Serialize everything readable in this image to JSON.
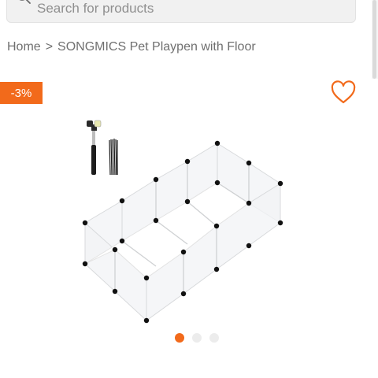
{
  "search": {
    "placeholder": "Search for products",
    "value": ""
  },
  "breadcrumb": {
    "home": "Home",
    "separator": ">",
    "current": "SONGMICS Pet Playpen with Floor"
  },
  "product": {
    "discount_badge": "-3%",
    "image_name": "pet-playpen-image",
    "carousel": {
      "count": 3,
      "active_index": 0
    }
  },
  "icons": {
    "search": "search-icon",
    "wishlist": "heart-icon"
  },
  "colors": {
    "accent": "#f26a1b",
    "dot_inactive": "#ececec",
    "text_muted": "#707070",
    "search_bg": "#f1f1f1"
  }
}
